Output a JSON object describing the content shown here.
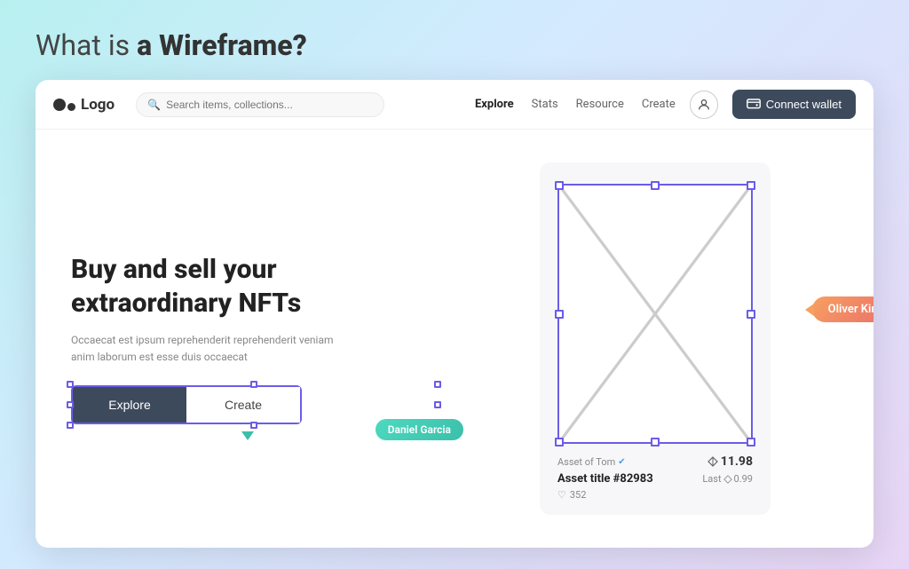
{
  "page": {
    "title_prefix": "What is ",
    "title_bold": "a Wireframe?"
  },
  "navbar": {
    "logo_text": "Logo",
    "search_placeholder": "Search items, collections...",
    "nav_links": [
      {
        "label": "Explore",
        "active": true
      },
      {
        "label": "Stats",
        "active": false
      },
      {
        "label": "Resource",
        "active": false
      },
      {
        "label": "Create",
        "active": false
      }
    ],
    "connect_wallet_label": "Connect wallet"
  },
  "hero": {
    "heading_line1": "Buy and sell your",
    "heading_line2": "extraordinary NFTs",
    "subtitle": "Occaecat est ipsum reprehenderit reprehenderit veniam anim laborum est esse duis occaecat",
    "btn_explore": "Explore",
    "btn_create": "Create",
    "tag_daniel": "Daniel Garcia",
    "tag_oliver": "Oliver King"
  },
  "nft_card": {
    "owner": "Asset of Tom",
    "asset_id": "Asset title #82983",
    "price": "11.98",
    "last_price": "0.99",
    "likes": "352"
  }
}
